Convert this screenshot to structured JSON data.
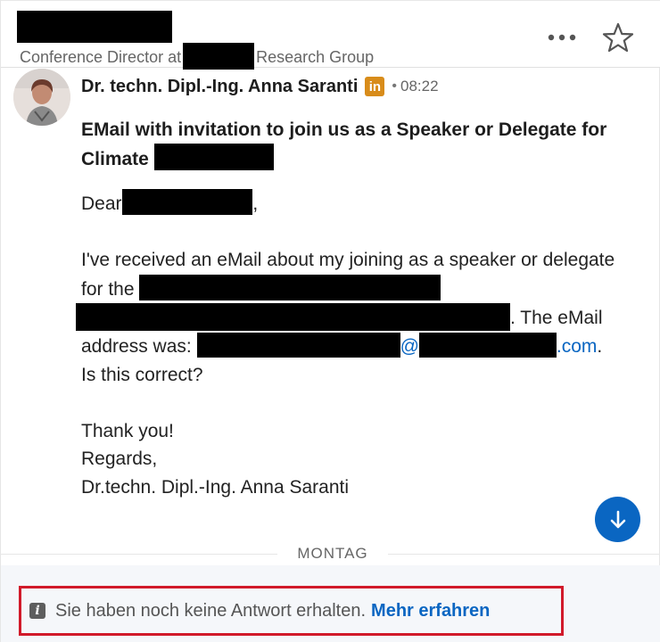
{
  "header": {
    "subtitle_prefix": "Conference Director at",
    "subtitle_suffix": "Research Group",
    "more_icon": "more-horizontal-icon",
    "star_icon": "star-outline-icon"
  },
  "message": {
    "sender": "Dr. techn. Dipl.-Ing. Anna Saranti",
    "linkedin_badge": "in",
    "separator": "•",
    "time": "08:22",
    "subject": "EMail with invitation to join us as a Speaker or Delegate for Climate",
    "greeting": "Dear",
    "greeting_suffix": ",",
    "para1_a": "I've received an eMail about my joining as a speaker or delegate for the",
    "para1_b": ". The eMail address was:",
    "at_sign": "@",
    "domain_tld": ".com",
    "para1_c": ". Is this correct?",
    "thanks": "Thank you!",
    "regards": "Regards,",
    "signature": "Dr.techn. Dipl.-Ing. Anna Saranti"
  },
  "day_divider": "MONTAG",
  "notice": {
    "icon": "info-icon",
    "text": "Sie haben noch keine Antwort erhalten.",
    "link": "Mehr erfahren"
  },
  "colors": {
    "accent": "#0a66c2",
    "linkedin_badge": "#d88c1a",
    "notice_border": "#d11a2a",
    "redaction": "#000000"
  }
}
